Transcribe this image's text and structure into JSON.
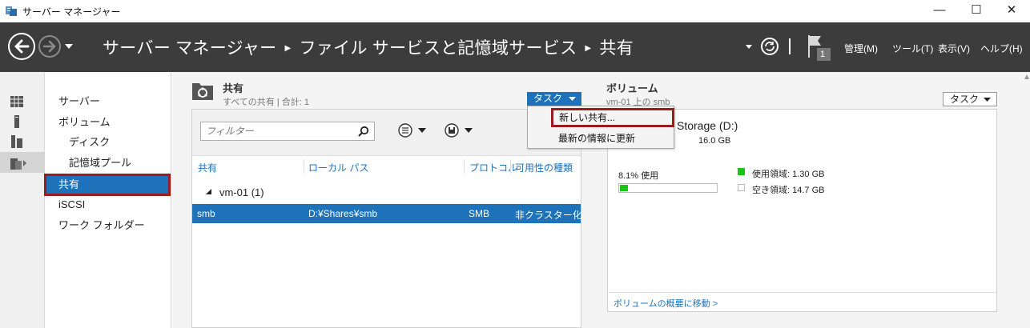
{
  "window": {
    "title": "サーバー マネージャー",
    "controls": {
      "minimize": "—",
      "maximize": "☐",
      "close": "✕"
    }
  },
  "header": {
    "breadcrumb": [
      "サーバー マネージャー",
      "ファイル サービスと記憶域サービス",
      "共有"
    ],
    "separator": "▶",
    "notification_count": "1",
    "menu": [
      "管理(M)",
      "ツール(T)",
      "表示(V)",
      "ヘルプ(H)"
    ]
  },
  "rail": {
    "icons": [
      "dashboard-icon",
      "server-icon",
      "servers-icon",
      "file-services-icon"
    ]
  },
  "sidebar": {
    "items": [
      {
        "label": "サーバー"
      },
      {
        "label": "ボリューム"
      },
      {
        "label": "ディスク"
      },
      {
        "label": "記憶域プール"
      },
      {
        "label": "共有"
      },
      {
        "label": "iSCSI"
      },
      {
        "label": "ワーク フォルダー"
      }
    ]
  },
  "shares": {
    "title": "共有",
    "subtitle": "すべての共有 | 合計: 1",
    "task_label": "タスク",
    "filter_placeholder": "フィルター",
    "columns": [
      "共有",
      "ローカル パス",
      "プロトコル",
      "可用性の種類"
    ],
    "group": "vm-01 (1)",
    "rows": [
      {
        "share": "smb",
        "path": "D:¥Shares¥smb",
        "protocol": "SMB",
        "availability": "非クラスター化"
      }
    ]
  },
  "task_menu": {
    "items": [
      "新しい共有...",
      "最新の情報に更新"
    ]
  },
  "volume": {
    "title": "ボリューム",
    "subtitle": "vm-01 上の smb",
    "task_label": "タスク",
    "name": "Storage (D:)",
    "size": "16.0 GB",
    "usage_text": "8.1% 使用",
    "usage_fraction": 0.081,
    "used_label": "使用領域: 1.30 GB",
    "free_label": "空き領域: 14.7 GB",
    "link": "ボリュームの概要に移動 >",
    "colors": {
      "used": "#19c419",
      "accent": "#1e72b9",
      "highlight": "#9b1b23"
    }
  }
}
